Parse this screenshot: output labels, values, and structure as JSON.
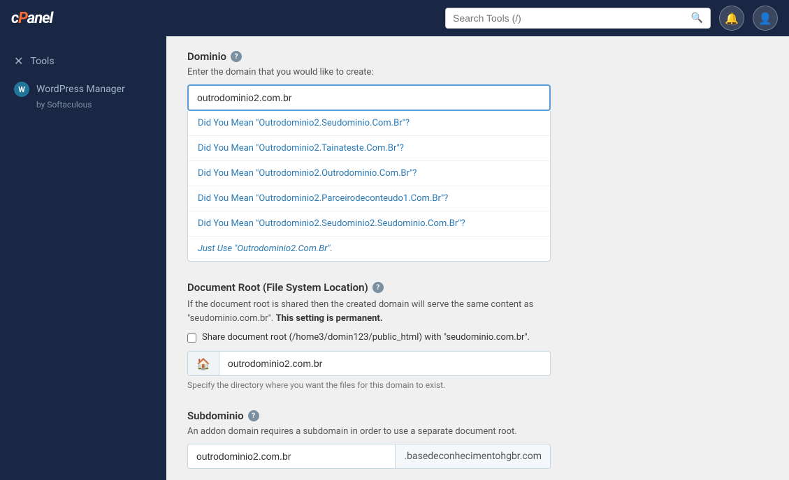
{
  "header": {
    "logo_text": "cPanel",
    "search_placeholder": "Search Tools (/)",
    "search_value": ""
  },
  "sidebar": {
    "items": [
      {
        "id": "tools",
        "label": "Tools",
        "icon": "✕"
      },
      {
        "id": "wordpress-manager",
        "label": "WordPress Manager",
        "sub": "by Softaculous"
      }
    ]
  },
  "main": {
    "dominio": {
      "title": "Dominio",
      "description": "Enter the domain that you would like to create:",
      "value": "outrodominio2.com.br",
      "suggestions": [
        "Did You Mean \"Outrodominio2.Seudominio.Com.Br\"?",
        "Did You Mean \"Outrodominio2.Tainateste.Com.Br\"?",
        "Did You Mean \"Outrodominio2.Outrodominio.Com.Br\"?",
        "Did You Mean \"Outrodominio2.Parceirodeconteudo1.Com.Br\"?",
        "Did You Mean \"Outrodominio2.Seudominio2.Seudominio.Com.Br\"?",
        "Just Use \"Outrodominio2.Com.Br\"."
      ]
    },
    "document_root": {
      "title": "Document Root (File System Location)",
      "warning": "If the document root is shared then the created domain will serve the same content as \"seudominio.com.br\".",
      "warning_strong": "This setting is permanent.",
      "checkbox_label": "Share document root (/home3/domin123/public_html) with \"seudominio.com.br\".",
      "dir_value": "outrodominio2.com.br",
      "dir_hint": "Specify the directory where you want the files for this domain to exist."
    },
    "subdominio": {
      "title": "Subdominio",
      "description": "An addon domain requires a subdomain in order to use a separate document root.",
      "left_value": "outrodominio2.com.br",
      "right_value": ".basedeconhecimentohgbr.com"
    }
  }
}
